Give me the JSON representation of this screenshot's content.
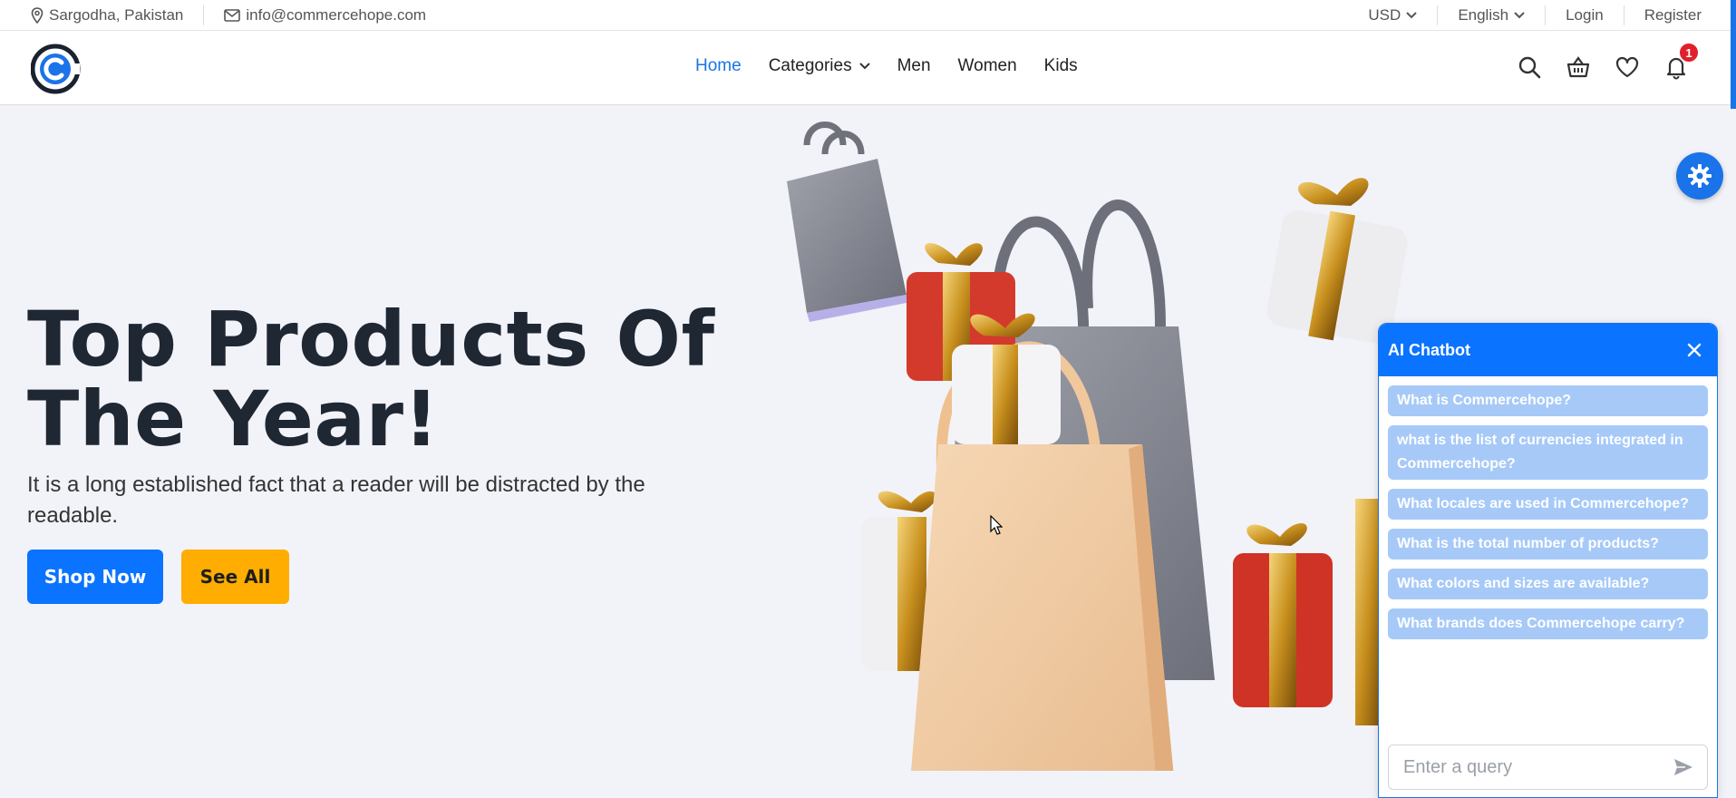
{
  "topbar": {
    "location": "Sargodha, Pakistan",
    "email": "info@commercehope.com",
    "currency": "USD",
    "language": "English",
    "login": "Login",
    "register": "Register"
  },
  "nav": {
    "home": "Home",
    "categories": "Categories",
    "men": "Men",
    "women": "Women",
    "kids": "Kids",
    "notification_count": "1"
  },
  "hero": {
    "title_line1": "Top Products Of",
    "title_line2": "The Year!",
    "subtitle": "It is a long established fact that a reader will be distracted by the readable.",
    "shop_label": "Shop Now",
    "see_label": "See All"
  },
  "chatbot": {
    "title": "AI Chatbot",
    "suggestions": [
      "What is Commercehope?",
      "what is the list of currencies integrated in Commercehope?",
      "What locales are used in Commercehope?",
      "What is the total number of products?",
      "What colors and sizes are available?",
      "What brands does Commercehope carry?"
    ],
    "placeholder": "Enter a query"
  },
  "colors": {
    "primary": "#0a73ff",
    "accent": "#ffad00",
    "chip": "#a6c9f8",
    "badge": "#e0202b"
  }
}
